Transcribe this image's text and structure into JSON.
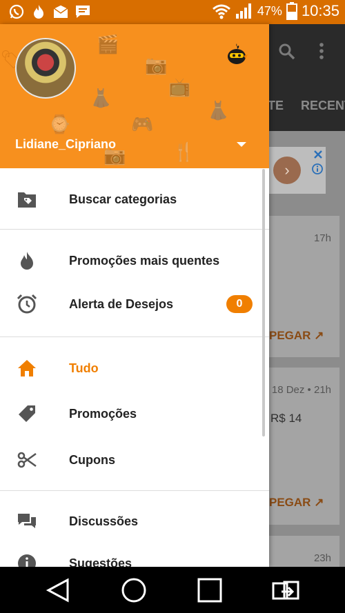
{
  "status_bar": {
    "notification_icons": [
      "whatsapp-icon",
      "fire-icon",
      "mail-icon",
      "message-icon"
    ],
    "battery_percent": "47%",
    "time": "10:35"
  },
  "background": {
    "tabs": [
      "TE",
      "RECENT"
    ],
    "cards": [
      {
        "time": "17h",
        "action": "PEGAR"
      },
      {
        "time": "18 Dez • 21h",
        "price": "R$ 14",
        "action": "PEGAR"
      },
      {
        "time": "23h"
      }
    ]
  },
  "drawer": {
    "username": "Lidiane_Cipriano",
    "menu": [
      {
        "icon": "folder-tag-icon",
        "label": "Buscar categorias"
      },
      {
        "icon": "flame-icon",
        "label": "Promoções mais quentes"
      },
      {
        "icon": "alarm-clock-icon",
        "label": "Alerta de Desejos",
        "badge": "0"
      },
      {
        "icon": "home-icon",
        "label": "Tudo",
        "active": true
      },
      {
        "icon": "tag-icon",
        "label": "Promoções"
      },
      {
        "icon": "scissors-icon",
        "label": "Cupons"
      },
      {
        "icon": "chat-bubbles-icon",
        "label": "Discussões"
      },
      {
        "icon": "info-icon",
        "label": "Sugestões"
      }
    ]
  },
  "colors": {
    "accent": "#f07f00",
    "header": "#f7901e",
    "status_bar": "#d86e00"
  }
}
